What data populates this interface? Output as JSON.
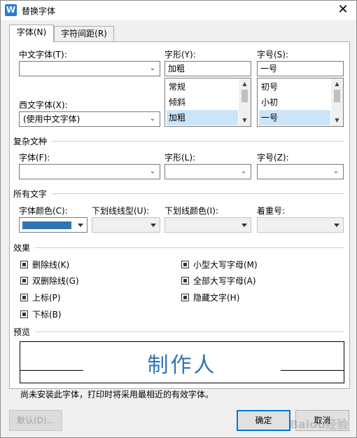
{
  "window": {
    "title": "替换字体",
    "app_icon_letter": "W",
    "close_glyph": "✕"
  },
  "tabs": [
    {
      "label": "字体(N)",
      "active": true
    },
    {
      "label": "字符间距(R)",
      "active": false
    }
  ],
  "font": {
    "chinese_label": "中文字体(T):",
    "chinese_value": "",
    "western_label": "西文字体(X):",
    "western_value": "(使用中文字体)",
    "style_label": "字形(Y):",
    "style_value": "加粗",
    "style_options": [
      "常规",
      "倾斜",
      "加粗"
    ],
    "size_label": "字号(S):",
    "size_value": "一号",
    "size_options": [
      "初号",
      "小初",
      "一号"
    ]
  },
  "complex": {
    "group_title": "复杂文种",
    "font_label": "字体(F):",
    "style_label": "字形(L):",
    "size_label": "字号(Z):"
  },
  "all_text": {
    "group_title": "所有文字",
    "color_label": "字体颜色(C):",
    "color_value": "#2e75b6",
    "underline_type_label": "下划线线型(U):",
    "underline_color_label": "下划线颜色(I):",
    "emphasis_label": "着重号:"
  },
  "effects": {
    "group_title": "效果",
    "left": [
      "删除线(K)",
      "双删除线(G)",
      "上标(P)",
      "下标(B)"
    ],
    "right": [
      "小型大写字母(M)",
      "全部大写字母(A)",
      "隐藏文字(H)"
    ]
  },
  "preview": {
    "group_title": "预览",
    "sample_text": "制作人",
    "sample_color": "#2e75b6",
    "note": "尚未安装此字体，打印时将采用最相近的有效字体。"
  },
  "buttons": {
    "default": "默认(D)...",
    "ok": "确定",
    "cancel": "取消"
  },
  "watermark": "Baidu经验"
}
